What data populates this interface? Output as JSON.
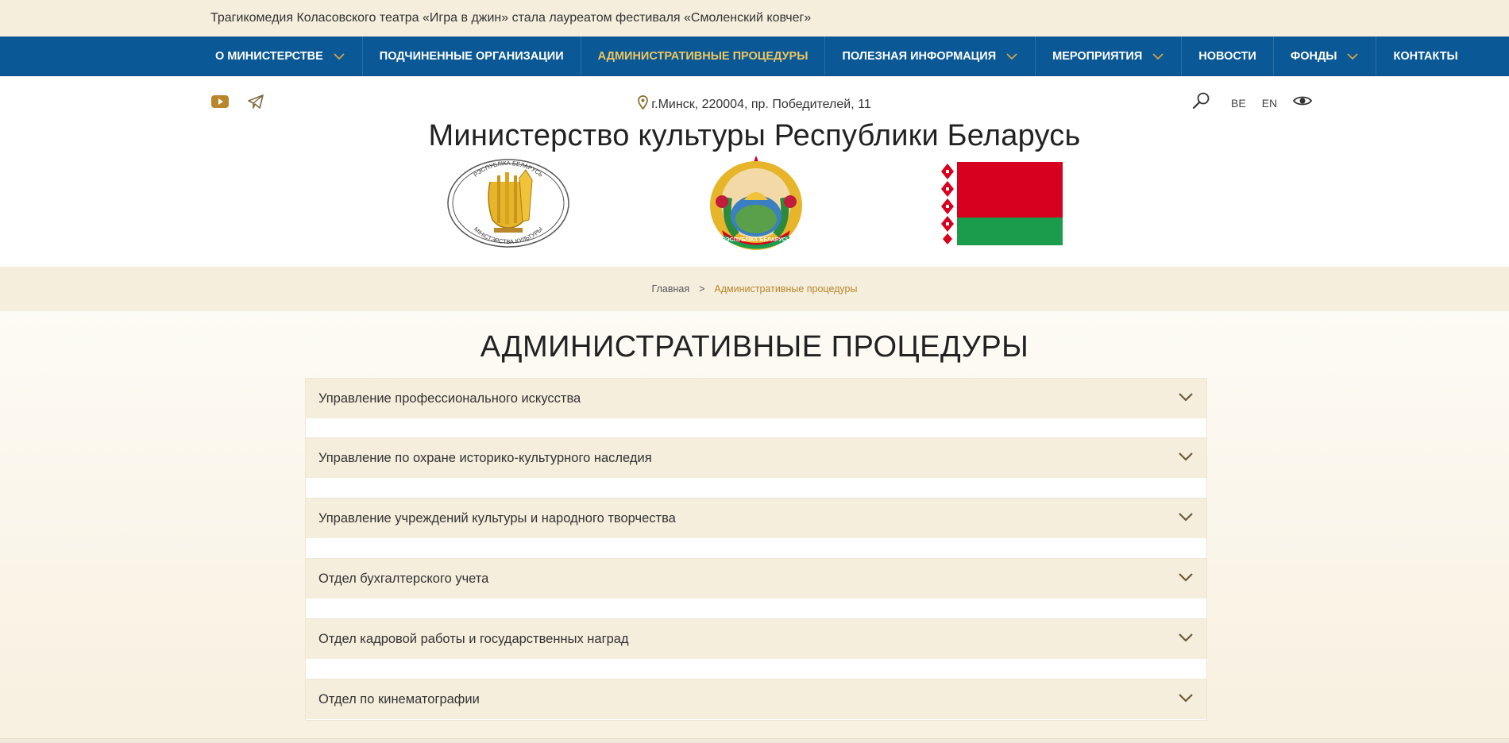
{
  "ticker": {
    "text": "Трагикомедия Коласовского театра «Игра в джин» стала лауреатом фестиваля «Смоленский ковчег»"
  },
  "nav": {
    "items": [
      {
        "label": "О МИНИСТЕРСТВЕ",
        "dropdown": true,
        "active": false
      },
      {
        "label": "ПОДЧИНЕННЫЕ ОРГАНИЗАЦИИ",
        "dropdown": false,
        "active": false
      },
      {
        "label": "АДМИНИСТРАТИВНЫЕ ПРОЦЕДУРЫ",
        "dropdown": false,
        "active": true
      },
      {
        "label": "ПОЛЕЗНАЯ ИНФОРМАЦИЯ",
        "dropdown": true,
        "active": false
      },
      {
        "label": "МЕРОПРИЯТИЯ",
        "dropdown": true,
        "active": false
      },
      {
        "label": "НОВОСТИ",
        "dropdown": false,
        "active": false
      },
      {
        "label": "ФОНДЫ",
        "dropdown": true,
        "active": false
      },
      {
        "label": "КОНТАКТЫ",
        "dropdown": false,
        "active": false
      }
    ]
  },
  "header": {
    "address": "г.Минск, 220004, пр. Победителей, 11",
    "languages": [
      "BE",
      "EN"
    ],
    "title": "Министерство культуры Республики Беларусь",
    "emblem_ministry_top_text": "РЭСПУБЛІКА БЕЛАРУСЬ",
    "emblem_ministry_bottom_text": "МІНІСТЭРСТВА КУЛЬТУРЫ",
    "coat_of_arms_ribbon_text": "РЭСПУБЛІКА БЕЛАРУСЬ"
  },
  "breadcrumb": {
    "home": "Главная",
    "separator": ">",
    "current": "Административные процедуры"
  },
  "page": {
    "title": "АДМИНИСТРАТИВНЫЕ ПРОЦЕДУРЫ",
    "accordion": [
      "Управление профессионального искусства",
      "Управление по охране историко-культурного наследия",
      "Управление учреждений культуры и народного творчества",
      "Отдел бухгалтерского учета",
      "Отдел кадровой работы и государственных наград",
      "Отдел по кинематографии"
    ]
  },
  "colors": {
    "nav_bg": "#0a5896",
    "accent_gold": "#b8862b",
    "active_nav": "#f0c75e",
    "cream": "#f5eedd",
    "flag_red": "#d8001f",
    "flag_green": "#1b9c4c"
  },
  "icons": {
    "youtube": "youtube-icon",
    "telegram": "telegram-icon",
    "location": "location-pin-icon",
    "search": "search-icon",
    "accessibility": "eye-icon",
    "chevron": "chevron-down-icon"
  }
}
